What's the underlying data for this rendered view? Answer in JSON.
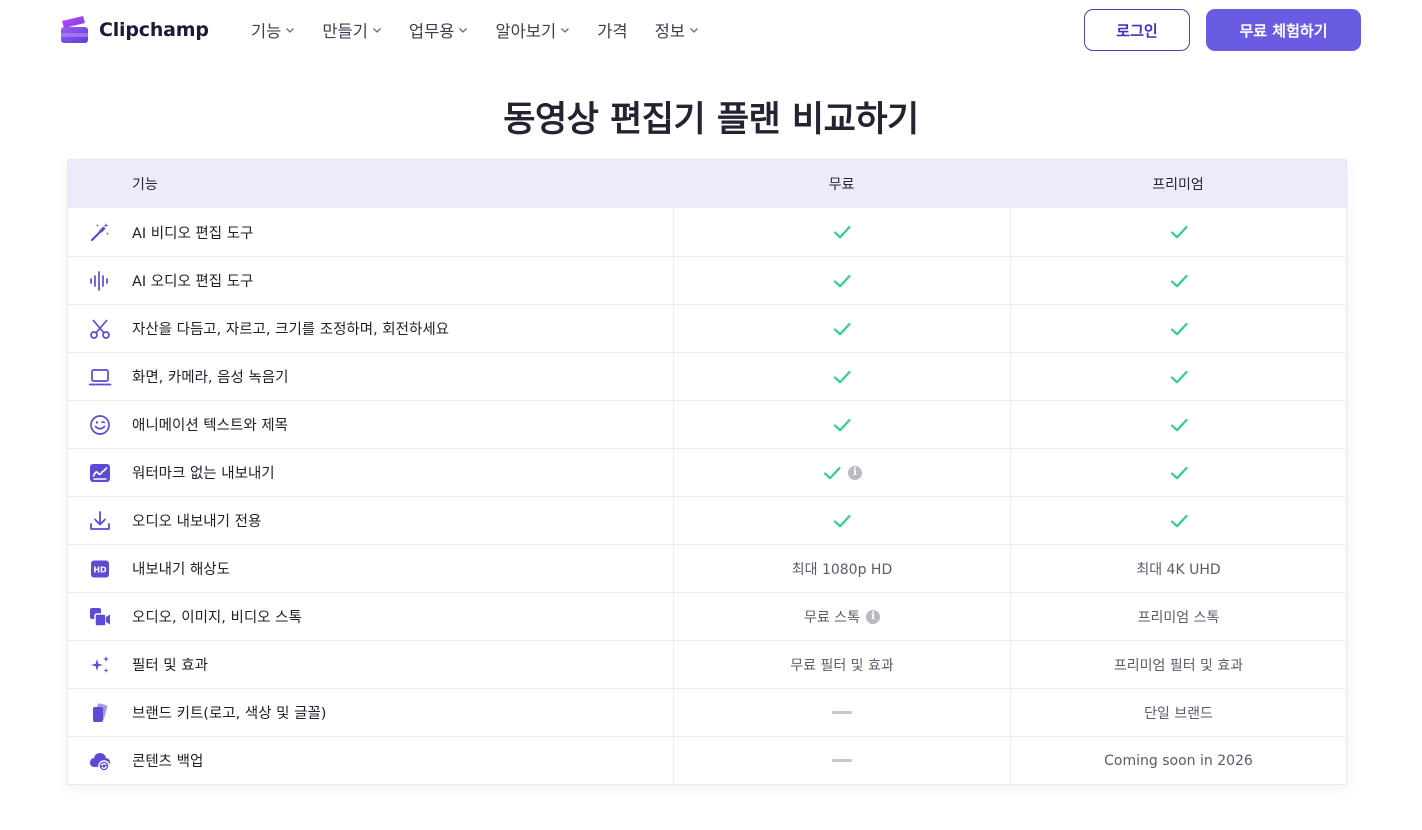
{
  "header": {
    "logo_text": "Clipchamp",
    "nav": [
      {
        "label": "기능",
        "has_dropdown": true
      },
      {
        "label": "만들기",
        "has_dropdown": true
      },
      {
        "label": "업무용",
        "has_dropdown": true
      },
      {
        "label": "알아보기",
        "has_dropdown": true
      },
      {
        "label": "가격",
        "has_dropdown": false
      },
      {
        "label": "정보",
        "has_dropdown": true
      }
    ],
    "login_label": "로그인",
    "trial_label": "무료 체험하기"
  },
  "page_title": "동영상 편집기 플랜 비교하기",
  "table": {
    "headers": {
      "feature": "기능",
      "free": "무료",
      "premium": "프리미엄"
    },
    "rows": [
      {
        "icon": "magic-wand-icon",
        "label": "AI 비디오 편집 도구",
        "free": "check",
        "premium": "check"
      },
      {
        "icon": "audio-wave-icon",
        "label": "AI 오디오 편집 도구",
        "free": "check",
        "premium": "check"
      },
      {
        "icon": "scissors-icon",
        "label": "자산을 다듬고, 자르고, 크기를 조정하며, 회전하세요",
        "free": "check",
        "premium": "check"
      },
      {
        "icon": "laptop-icon",
        "label": "화면, 카메라, 음성 녹음기",
        "free": "check",
        "premium": "check"
      },
      {
        "icon": "smiley-icon",
        "label": "애니메이션 텍스트와 제목",
        "free": "check",
        "premium": "check"
      },
      {
        "icon": "watermark-icon",
        "label": "워터마크 없는 내보내기",
        "free": "check-info",
        "premium": "check"
      },
      {
        "icon": "download-icon",
        "label": "오디오 내보내기 전용",
        "free": "check",
        "premium": "check"
      },
      {
        "icon": "hd-icon",
        "label": "내보내기 해상도",
        "free": "최대 1080p HD",
        "premium": "최대 4K UHD"
      },
      {
        "icon": "media-stock-icon",
        "label": "오디오, 이미지, 비디오 스톡",
        "free": "무료 스톡",
        "free_info": true,
        "premium": "프리미엄 스톡"
      },
      {
        "icon": "sparkles-icon",
        "label": "필터 및 효과",
        "free": "무료 필터 및 효과",
        "premium": "프리미엄 필터 및 효과"
      },
      {
        "icon": "brand-kit-icon",
        "label": "브랜드 키트(로고, 색상 및 글꼴)",
        "free": "dash",
        "premium": "단일 브랜드"
      },
      {
        "icon": "cloud-backup-icon",
        "label": "콘텐츠 백업",
        "free": "dash",
        "premium": "Coming soon in 2026"
      }
    ]
  },
  "colors": {
    "accent": "#6a5be3",
    "check": "#2fcf8f",
    "header_bg": "#ebebfa"
  }
}
